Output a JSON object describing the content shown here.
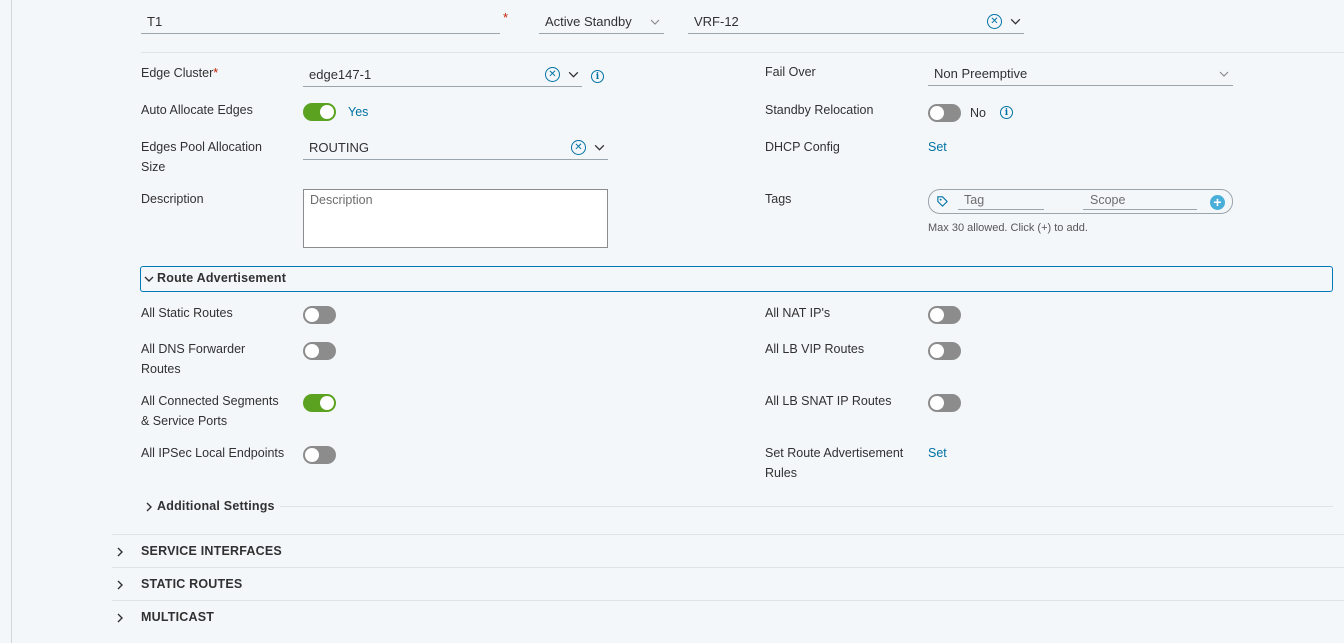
{
  "top": {
    "name_value": "T1",
    "ha_mode": "Active Standby",
    "vrf": "VRF-12"
  },
  "form": {
    "edge_cluster_label": "Edge Cluster",
    "edge_cluster_value": "edge147-1",
    "auto_allocate_label": "Auto Allocate Edges",
    "auto_allocate_state": "Yes",
    "pool_label_line1": "Edges Pool Allocation",
    "pool_label_line2": "Size",
    "pool_value": "ROUTING",
    "description_label": "Description",
    "description_placeholder": "Description",
    "failover_label": "Fail Over",
    "failover_value": "Non Preemptive",
    "standby_label": "Standby Relocation",
    "standby_state": "No",
    "dhcp_label": "DHCP Config",
    "dhcp_link": "Set",
    "tags_label": "Tags",
    "tag_placeholder": "Tag",
    "scope_placeholder": "Scope",
    "tags_hint": "Max 30 allowed. Click (+) to add."
  },
  "route_adv": {
    "title": "Route Advertisement",
    "static_routes": "All Static Routes",
    "dns_line1": "All DNS Forwarder",
    "dns_line2": "Routes",
    "connected_line1": "All Connected Segments",
    "connected_line2": "& Service Ports",
    "ipsec": "All IPSec Local Endpoints",
    "nat": "All NAT IP's",
    "lb_vip": "All LB VIP Routes",
    "lb_snat": "All LB SNAT IP Routes",
    "rules_line1": "Set Route Advertisement",
    "rules_line2": "Rules",
    "rules_link": "Set",
    "toggles": {
      "static_routes": false,
      "dns": false,
      "connected": true,
      "ipsec": false,
      "nat": false,
      "lb_vip": false,
      "lb_snat": false
    }
  },
  "additional_settings": "Additional Settings",
  "sections": {
    "service_interfaces": "SERVICE INTERFACES",
    "static_routes": "STATIC ROUTES",
    "multicast": "MULTICAST"
  },
  "colors": {
    "accent": "#0072a3",
    "toggle_on": "#5aa220",
    "toggle_off": "#8c8c8c",
    "required": "#c21d00"
  }
}
